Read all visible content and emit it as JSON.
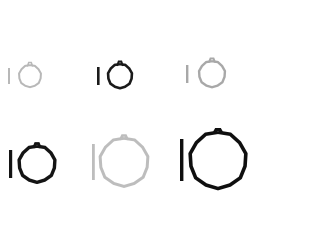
{
  "image": {
    "background": "#ffffff",
    "items": [
      {
        "name": "ring-small-light",
        "icon": "retaining-ring-icon",
        "color": "#b8b8b8",
        "weight": "thin"
      },
      {
        "name": "ring-small-dark",
        "icon": "retaining-ring-icon",
        "color": "#1a1a1a",
        "weight": "medium"
      },
      {
        "name": "ring-small-grey",
        "icon": "retaining-ring-icon",
        "color": "#a8a8a8",
        "weight": "medium"
      },
      {
        "name": "ring-large-dark",
        "icon": "retaining-ring-icon",
        "color": "#141414",
        "weight": "heavy"
      },
      {
        "name": "ring-large-light",
        "icon": "retaining-ring-icon",
        "color": "#bdbdbd",
        "weight": "medium"
      },
      {
        "name": "ring-large-black",
        "icon": "retaining-ring-icon",
        "color": "#0f0f0f",
        "weight": "heavy"
      }
    ]
  }
}
